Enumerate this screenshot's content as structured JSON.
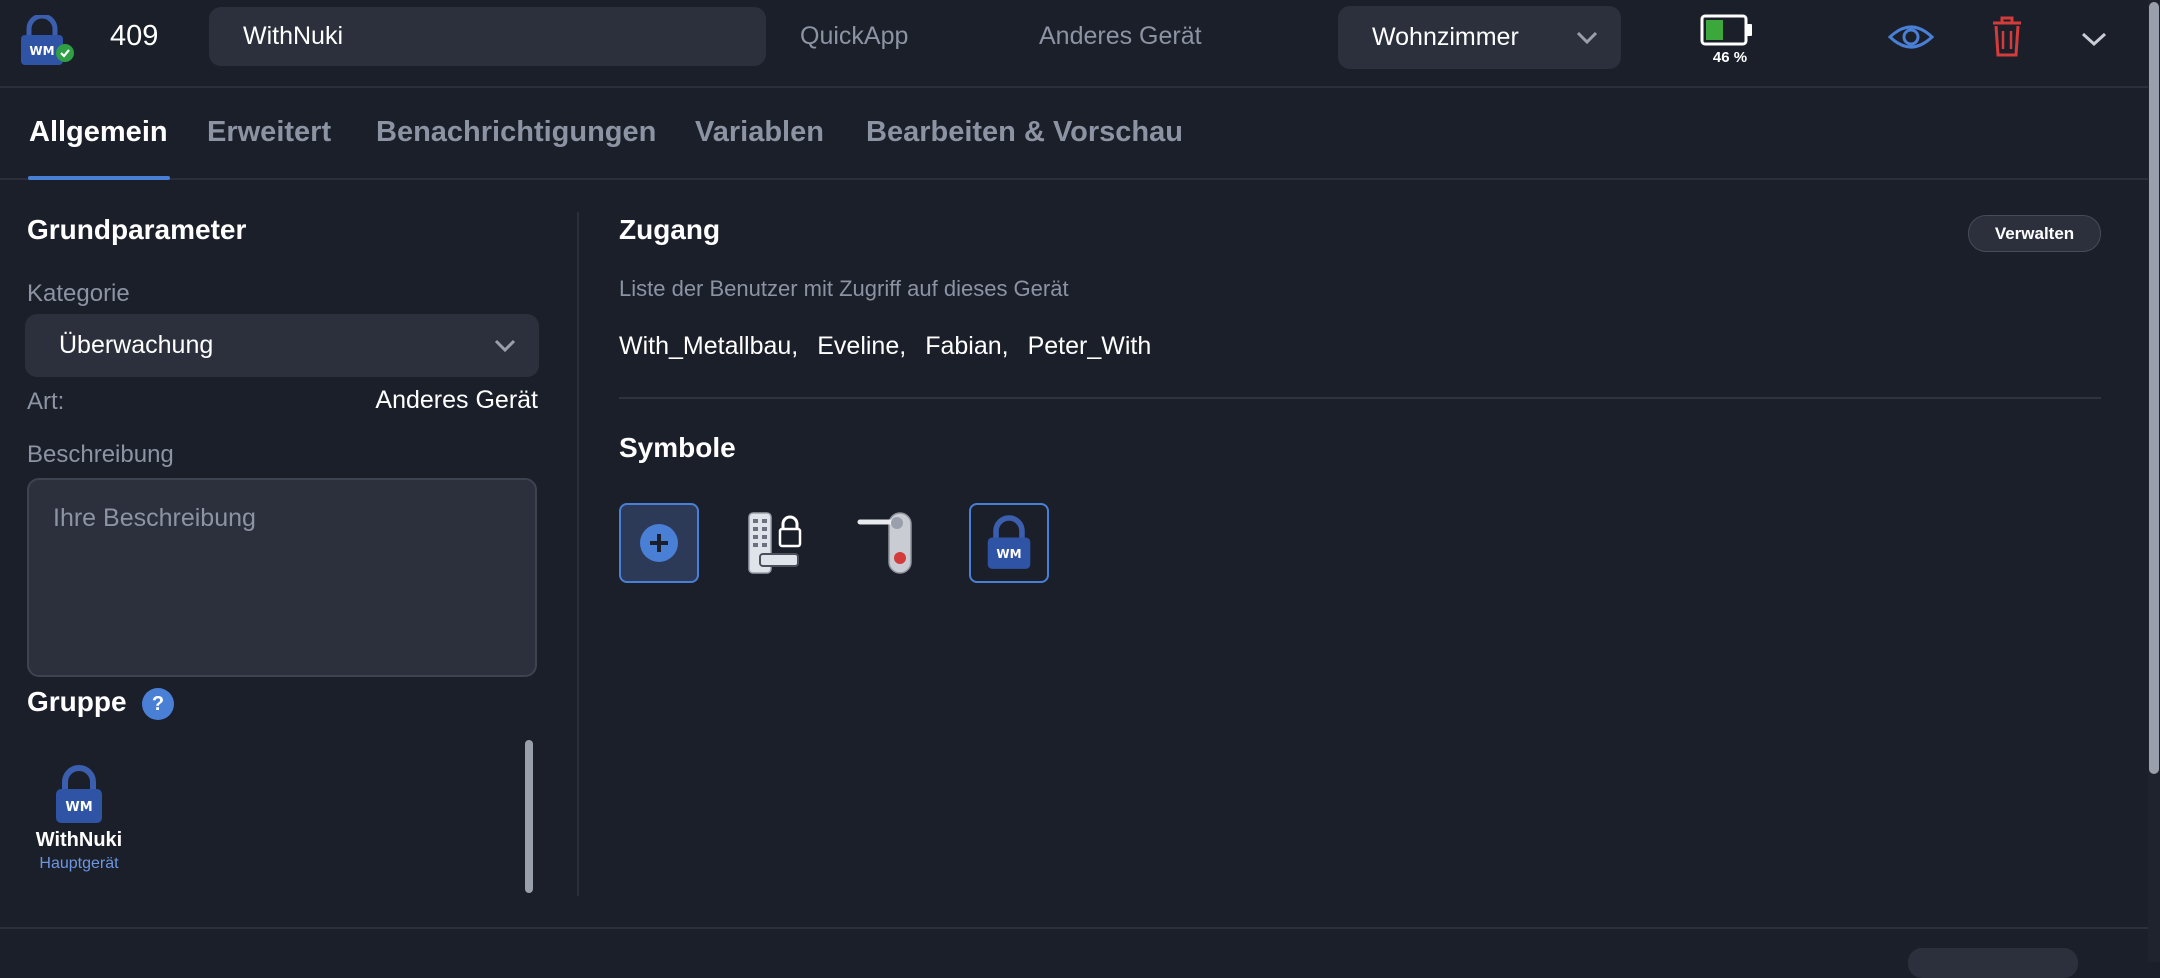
{
  "header": {
    "device_id": "409",
    "device_name": "WithNuki",
    "type_label": "QuickApp",
    "kind_label": "Anderes Gerät",
    "room": "Wohnzimmer",
    "battery_level": 0.46,
    "battery_label": "46 %",
    "icons": [
      "lock-icon",
      "battery-icon",
      "eye-icon",
      "trash-icon",
      "chevron-down-icon"
    ]
  },
  "tabs": [
    {
      "label": "Allgemein",
      "active": true
    },
    {
      "label": "Erweitert",
      "active": false
    },
    {
      "label": "Benachrichtigungen",
      "active": false
    },
    {
      "label": "Variablen",
      "active": false
    },
    {
      "label": "Bearbeiten & Vorschau",
      "active": false
    }
  ],
  "basic": {
    "title": "Grundparameter",
    "category_label": "Kategorie",
    "category_value": "Überwachung",
    "art_label": "Art:",
    "art_value": "Anderes Gerät",
    "description_label": "Beschreibung",
    "description_placeholder": "Ihre Beschreibung"
  },
  "group": {
    "title": "Gruppe",
    "help": "?",
    "device_name": "WithNuki",
    "device_role": "Hauptgerät"
  },
  "access": {
    "title": "Zugang",
    "manage_label": "Verwalten",
    "description": "Liste der Benutzer mit Zugriff auf dieses Gerät",
    "users": [
      "With_Metallbau,",
      "Eveline,",
      "Fabian,",
      "Peter_With"
    ]
  },
  "symbols": {
    "title": "Symbole",
    "items": [
      "add-symbol-icon",
      "keypad-lock-icon",
      "door-handle-icon",
      "padlock-icon"
    ]
  },
  "colors": {
    "background": "#1b1f2a",
    "surface": "#2b303c",
    "accent": "#4a7fd6",
    "muted_text": "#8c93a3",
    "danger": "#d43b3b",
    "battery_green": "#3ca83c"
  }
}
